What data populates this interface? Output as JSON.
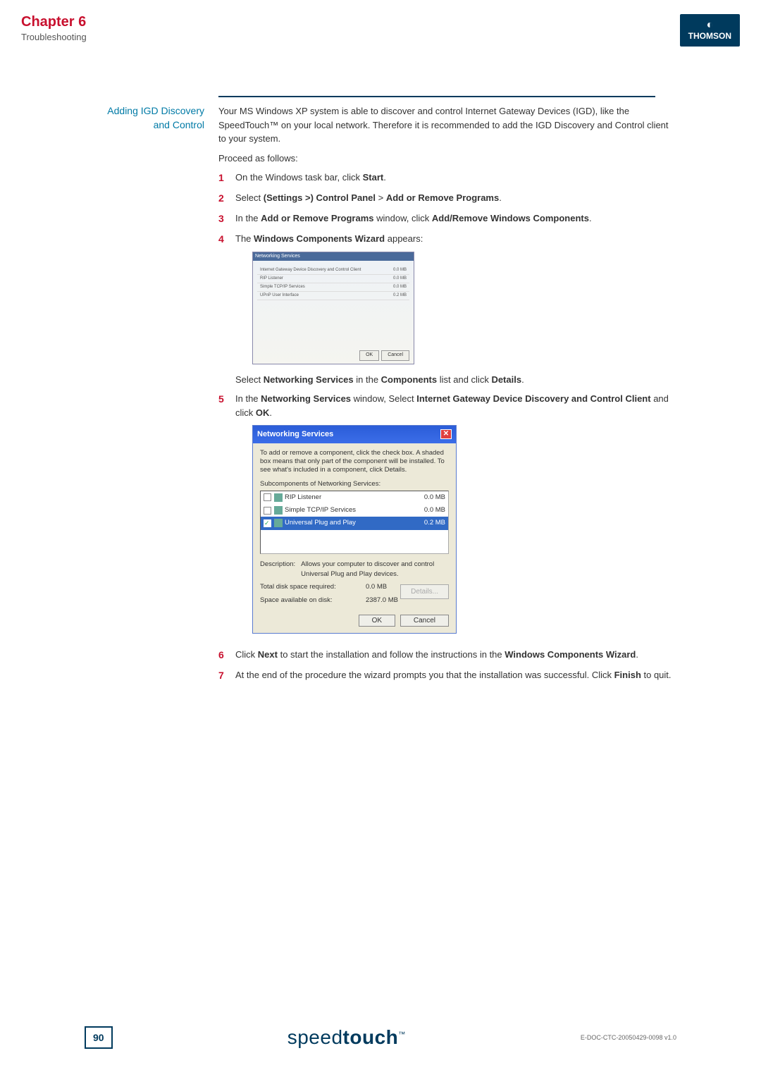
{
  "header": {
    "chapter": "Chapter 6",
    "subtitle": "Troubleshooting",
    "logo_name": "THOMSON"
  },
  "section": {
    "side_label_line1": "Adding IGD Discovery",
    "side_label_line2": "and Control",
    "intro": "Your MS Windows XP system is able to discover and control Internet Gateway Devices (IGD), like the SpeedTouch™ on your local network. Therefore it is recommended to add the IGD Discovery and Control client to your system.",
    "proceed": "Proceed as follows:"
  },
  "steps": {
    "s1": {
      "num": "1",
      "pre": "On the Windows task bar, click ",
      "bold": "Start",
      "post": "."
    },
    "s2": {
      "num": "2",
      "pre": "Select ",
      "b1": "(Settings >) Control Panel",
      "mid": " > ",
      "b2": "Add or Remove Programs",
      "post": "."
    },
    "s3": {
      "num": "3",
      "pre": "In the ",
      "b1": "Add or Remove Programs",
      "mid": " window, click ",
      "b2": "Add/Remove Windows Components",
      "post": "."
    },
    "s4": {
      "num": "4",
      "pre": "The ",
      "b1": "Windows Components Wizard",
      "post": " appears:",
      "caption_pre": "Select ",
      "caption_b1": "Networking Services",
      "caption_mid": " in the ",
      "caption_b2": "Components",
      "caption_mid2": " list and click ",
      "caption_b3": "Details",
      "caption_post": "."
    },
    "s5": {
      "num": "5",
      "pre": "In the ",
      "b1": "Networking Services",
      "mid": " window, Select ",
      "b2": "Internet Gateway Device Discovery and Control Client",
      "mid2": " and click ",
      "b3": "OK",
      "post": "."
    },
    "s6": {
      "num": "6",
      "pre": "Click ",
      "b1": "Next",
      "mid": " to start the installation and follow the instructions in the ",
      "b2": "Windows Components Wizard",
      "post": "."
    },
    "s7": {
      "num": "7",
      "pre": "At the end of the procedure the wizard prompts you that the installation was successful. Click ",
      "b1": "Finish",
      "post": " to quit."
    }
  },
  "wizard_small": {
    "title": "Networking Services",
    "row1": {
      "name": "Internet Gateway Device Discovery and Control Client",
      "size": "0.0 MB"
    },
    "row2": {
      "name": "RIP Listener",
      "size": "0.0 MB"
    },
    "row3": {
      "name": "Simple TCP/IP Services",
      "size": "0.0 MB"
    },
    "row4": {
      "name": "UPnP User Interface",
      "size": "0.2 MB"
    },
    "ok": "OK",
    "cancel": "Cancel"
  },
  "dialog": {
    "title": "Networking Services",
    "desc": "To add or remove a component, click the check box. A shaded box means that only part of the component will be installed. To see what's included in a component, click Details.",
    "sub_label": "Subcomponents of Networking Services:",
    "items": [
      {
        "name": "RIP Listener",
        "size": "0.0 MB",
        "checked": false,
        "selected": false
      },
      {
        "name": "Simple TCP/IP Services",
        "size": "0.0 MB",
        "checked": false,
        "selected": false
      },
      {
        "name": "Universal Plug and Play",
        "size": "0.2 MB",
        "checked": true,
        "selected": true
      }
    ],
    "desc_label": "Description:",
    "desc_text": "Allows your computer to discover and control Universal Plug and Play devices.",
    "total_label": "Total disk space required:",
    "total_value": "0.0 MB",
    "avail_label": "Space available on disk:",
    "avail_value": "2387.0 MB",
    "details_btn": "Details...",
    "ok": "OK",
    "cancel": "Cancel"
  },
  "footer": {
    "page": "90",
    "brand_thin": "speed",
    "brand_bold": "touch",
    "brand_tm": "™",
    "docref": "E-DOC-CTC-20050429-0098 v1.0"
  }
}
